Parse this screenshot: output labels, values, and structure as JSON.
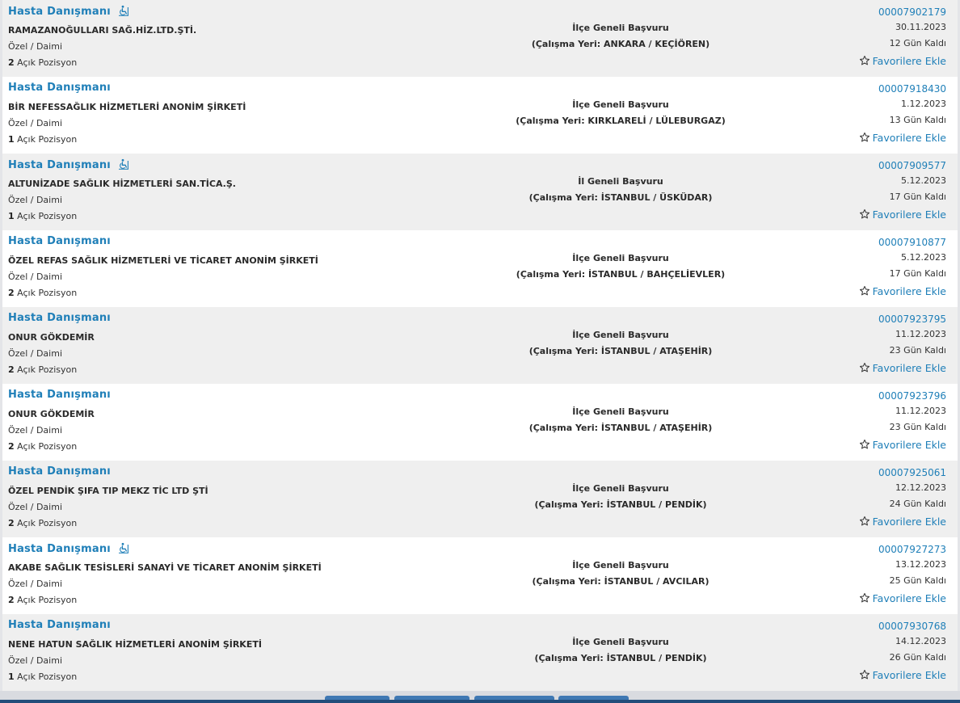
{
  "listings": [
    {
      "title": "Hasta Danışmanı",
      "accessible": true,
      "company": "RAMAZANOĞULLARI SAĞ.HİZ.LTD.ŞTİ.",
      "type": "Özel / Daimi",
      "positions": "2",
      "positions_label": "Açık Pozisyon",
      "scope": "İlçe Geneli Başvuru",
      "location": "(Çalışma Yeri: ANKARA / KEÇİÖREN)",
      "id": "00007902179",
      "date": "30.11.2023",
      "days_left": "12 Gün Kaldı",
      "fav_label": "Favorilere Ekle"
    },
    {
      "title": "Hasta Danışmanı",
      "accessible": false,
      "company": "BİR NEFESSAĞLIK HİZMETLERİ ANONİM ŞİRKETİ",
      "type": "Özel / Daimi",
      "positions": "1",
      "positions_label": "Açık Pozisyon",
      "scope": "İlçe Geneli Başvuru",
      "location": "(Çalışma Yeri: KIRKLARELİ / LÜLEBURGAZ)",
      "id": "00007918430",
      "date": "1.12.2023",
      "days_left": "13 Gün Kaldı",
      "fav_label": "Favorilere Ekle"
    },
    {
      "title": "Hasta Danışmanı",
      "accessible": true,
      "company": "ALTUNİZADE SAĞLIK HİZMETLERİ SAN.TİCA.Ş.",
      "type": "Özel / Daimi",
      "positions": "1",
      "positions_label": "Açık Pozisyon",
      "scope": "İl Geneli Başvuru",
      "location": "(Çalışma Yeri: İSTANBUL / ÜSKÜDAR)",
      "id": "00007909577",
      "date": "5.12.2023",
      "days_left": "17 Gün Kaldı",
      "fav_label": "Favorilere Ekle"
    },
    {
      "title": "Hasta Danışmanı",
      "accessible": false,
      "company": "ÖZEL REFAS SAĞLIK HİZMETLERİ VE TİCARET ANONİM ŞİRKETİ",
      "type": "Özel / Daimi",
      "positions": "2",
      "positions_label": "Açık Pozisyon",
      "scope": "İlçe Geneli Başvuru",
      "location": "(Çalışma Yeri: İSTANBUL / BAHÇELİEVLER)",
      "id": "00007910877",
      "date": "5.12.2023",
      "days_left": "17 Gün Kaldı",
      "fav_label": "Favorilere Ekle"
    },
    {
      "title": "Hasta Danışmanı",
      "accessible": false,
      "company": "ONUR GÖKDEMİR",
      "type": "Özel / Daimi",
      "positions": "2",
      "positions_label": "Açık Pozisyon",
      "scope": "İlçe Geneli Başvuru",
      "location": "(Çalışma Yeri: İSTANBUL / ATAŞEHİR)",
      "id": "00007923795",
      "date": "11.12.2023",
      "days_left": "23 Gün Kaldı",
      "fav_label": "Favorilere Ekle"
    },
    {
      "title": "Hasta Danışmanı",
      "accessible": false,
      "company": "ONUR GÖKDEMİR",
      "type": "Özel / Daimi",
      "positions": "2",
      "positions_label": "Açık Pozisyon",
      "scope": "İlçe Geneli Başvuru",
      "location": "(Çalışma Yeri: İSTANBUL / ATAŞEHİR)",
      "id": "00007923796",
      "date": "11.12.2023",
      "days_left": "23 Gün Kaldı",
      "fav_label": "Favorilere Ekle"
    },
    {
      "title": "Hasta Danışmanı",
      "accessible": false,
      "company": "ÖZEL PENDİK ŞIFA TIP MEKZ TİC LTD ŞTİ",
      "type": "Özel / Daimi",
      "positions": "2",
      "positions_label": "Açık Pozisyon",
      "scope": "İlçe Geneli Başvuru",
      "location": "(Çalışma Yeri: İSTANBUL / PENDİK)",
      "id": "00007925061",
      "date": "12.12.2023",
      "days_left": "24 Gün Kaldı",
      "fav_label": "Favorilere Ekle"
    },
    {
      "title": "Hasta Danışmanı",
      "accessible": true,
      "company": "AKABE SAĞLIK TESİSLERİ SANAYİ VE TİCARET ANONİM ŞİRKETİ",
      "type": "Özel / Daimi",
      "positions": "2",
      "positions_label": "Açık Pozisyon",
      "scope": "İlçe Geneli Başvuru",
      "location": "(Çalışma Yeri: İSTANBUL / AVCILAR)",
      "id": "00007927273",
      "date": "13.12.2023",
      "days_left": "25 Gün Kaldı",
      "fav_label": "Favorilere Ekle"
    },
    {
      "title": "Hasta Danışmanı",
      "accessible": false,
      "company": "NENE HATUN SAĞLIK HİZMETLERİ ANONİM ŞİRKETİ",
      "type": "Özel / Daimi",
      "positions": "1",
      "positions_label": "Açık Pozisyon",
      "scope": "İlçe Geneli Başvuru",
      "location": "(Çalışma Yeri: İSTANBUL / PENDİK)",
      "id": "00007930768",
      "date": "14.12.2023",
      "days_left": "26 Gün Kaldı",
      "fav_label": "Favorilere Ekle"
    }
  ],
  "icons": {
    "accessible": "wheelchair-icon",
    "favorite": "star-outline-icon"
  },
  "colors": {
    "link": "#1f7fb8",
    "row_odd": "#efefef",
    "row_even": "#ffffff",
    "pagination": "#3f78b3"
  }
}
